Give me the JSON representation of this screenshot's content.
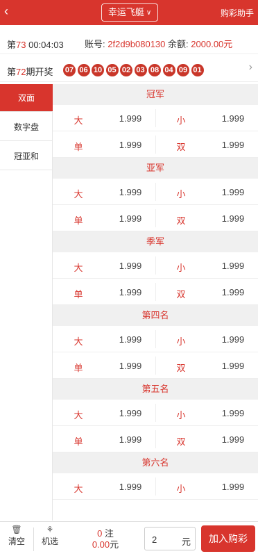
{
  "header": {
    "back_icon": "back-arrow-icon",
    "game_name": "幸运飞艇",
    "helper_label": "购彩助手"
  },
  "info": {
    "issue_prefix": "第",
    "issue_number": "73",
    "countdown": "00:04:03",
    "account_label": "账号:",
    "account_value": "2f2d9b080130",
    "balance_label": "余额:",
    "balance_value": "2000.00元"
  },
  "draw": {
    "prefix": "第",
    "issue": "72",
    "suffix": "期开奖",
    "balls": [
      "07",
      "06",
      "10",
      "05",
      "02",
      "03",
      "08",
      "04",
      "09",
      "01"
    ]
  },
  "sidebar": {
    "items": [
      {
        "label": "双面"
      },
      {
        "label": "数字盘"
      },
      {
        "label": "冠亚和"
      }
    ]
  },
  "sections": [
    {
      "title": "冠军",
      "rows": [
        {
          "a": "大",
          "ao": "1.999",
          "b": "小",
          "bo": "1.999"
        },
        {
          "a": "单",
          "ao": "1.999",
          "b": "双",
          "bo": "1.999"
        }
      ]
    },
    {
      "title": "亚军",
      "rows": [
        {
          "a": "大",
          "ao": "1.999",
          "b": "小",
          "bo": "1.999"
        },
        {
          "a": "单",
          "ao": "1.999",
          "b": "双",
          "bo": "1.999"
        }
      ]
    },
    {
      "title": "季军",
      "rows": [
        {
          "a": "大",
          "ao": "1.999",
          "b": "小",
          "bo": "1.999"
        },
        {
          "a": "单",
          "ao": "1.999",
          "b": "双",
          "bo": "1.999"
        }
      ]
    },
    {
      "title": "第四名",
      "rows": [
        {
          "a": "大",
          "ao": "1.999",
          "b": "小",
          "bo": "1.999"
        },
        {
          "a": "单",
          "ao": "1.999",
          "b": "双",
          "bo": "1.999"
        }
      ]
    },
    {
      "title": "第五名",
      "rows": [
        {
          "a": "大",
          "ao": "1.999",
          "b": "小",
          "bo": "1.999"
        },
        {
          "a": "单",
          "ao": "1.999",
          "b": "双",
          "bo": "1.999"
        }
      ]
    },
    {
      "title": "第六名",
      "rows": [
        {
          "a": "大",
          "ao": "1.999",
          "b": "小",
          "bo": "1.999"
        }
      ]
    }
  ],
  "footer": {
    "clear_label": "清空",
    "machine_label": "机选",
    "bet_count": "0",
    "bet_unit": "注",
    "total": "0.00",
    "total_unit": "元",
    "amount_value": "2",
    "amount_unit": "元",
    "add_label": "加入购彩"
  },
  "colors": {
    "accent": "#d8352d",
    "ball": "#c93629"
  }
}
